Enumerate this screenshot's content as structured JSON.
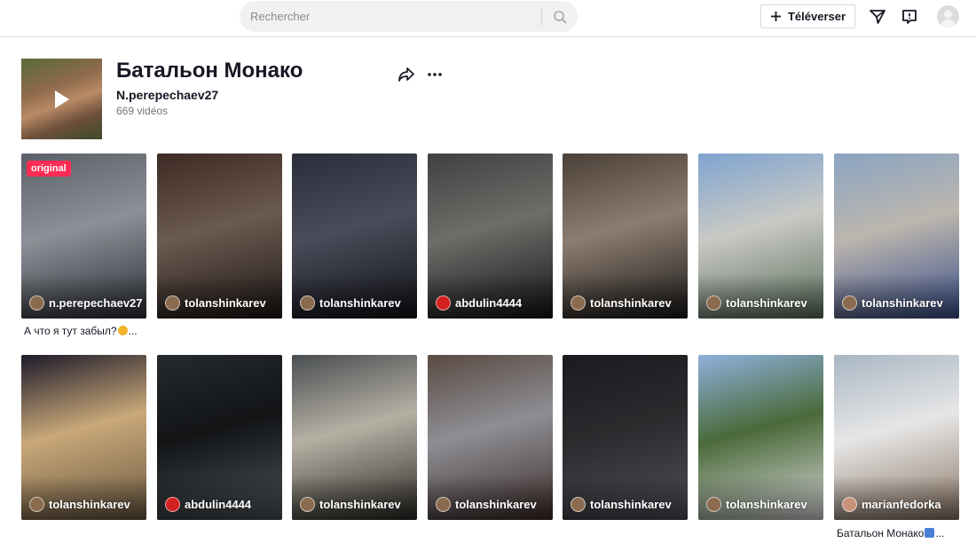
{
  "header": {
    "search_placeholder": "Rechercher",
    "upload_label": "Téléverser"
  },
  "playlist": {
    "title": "Батальон Монако",
    "author": "N.perepechaev27",
    "count": "669 vidéos"
  },
  "videos": [
    {
      "username": "n.perepechaev27",
      "badge": "original",
      "caption": "А что я тут забыл?",
      "caption_suffix": "...",
      "colors": [
        "#5b6068",
        "#2b2f36",
        "#8d9096"
      ]
    },
    {
      "username": "tolanshinkarev",
      "colors": [
        "#3c2a24",
        "#1e1816",
        "#6b5a50"
      ]
    },
    {
      "username": "tolanshinkarev",
      "colors": [
        "#2a2d3a",
        "#121318",
        "#4a4c5a"
      ]
    },
    {
      "username": "abdulin4444",
      "colors": [
        "#40413f",
        "#151515",
        "#6d6e6a"
      ]
    },
    {
      "username": "tolanshinkarev",
      "colors": [
        "#4a4038",
        "#1b1a1a",
        "#8d7d70"
      ]
    },
    {
      "username": "tolanshinkarev",
      "colors": [
        "#7fa4d0",
        "#5a6e5c",
        "#c9c9c4"
      ]
    },
    {
      "username": "tolanshinkarev",
      "colors": [
        "#8aa4c2",
        "#3b4f8a",
        "#bcb6ae"
      ]
    },
    {
      "username": "tolanshinkarev",
      "colors": [
        "#1d1a2a",
        "#6a5842",
        "#c9a879"
      ]
    },
    {
      "username": "abdulin4444",
      "colors": [
        "#262a2e",
        "#4d5358",
        "#121416"
      ]
    },
    {
      "username": "tolanshinkarev",
      "colors": [
        "#4a4e52",
        "#2c2a26",
        "#b6b0a4"
      ]
    },
    {
      "username": "tolanshinkarev",
      "colors": [
        "#5a4a42",
        "#3d2d2a",
        "#8e8e94"
      ]
    },
    {
      "username": "tolanshinkarev",
      "colors": [
        "#1a1b20",
        "#4d5058",
        "#2b2b2e"
      ]
    },
    {
      "username": "tolanshinkarev",
      "colors": [
        "#8fb1dd",
        "#d9d9d9",
        "#4a6a3a"
      ]
    },
    {
      "username": "marianfedorka",
      "caption": "Батальон Монако",
      "caption_suffix": "...",
      "colors": [
        "#a9b7c4",
        "#8c7766",
        "#e6e6e6"
      ]
    }
  ]
}
